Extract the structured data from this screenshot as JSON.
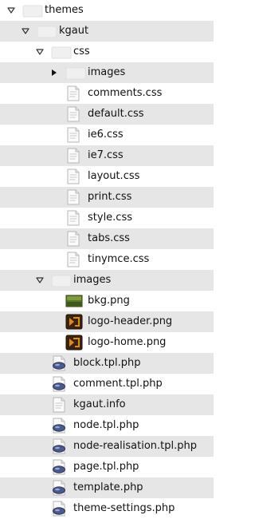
{
  "tree": [
    {
      "label": "themes",
      "kind": "folder",
      "state": "expanded",
      "level": 0
    },
    {
      "label": "kgaut",
      "kind": "folder",
      "state": "expanded",
      "level": 1
    },
    {
      "label": "css",
      "kind": "folder",
      "state": "expanded",
      "level": 2
    },
    {
      "label": "images",
      "kind": "folder",
      "state": "collapsed",
      "level": 3
    },
    {
      "label": "comments.css",
      "kind": "text-file",
      "level": 3
    },
    {
      "label": "default.css",
      "kind": "text-file",
      "level": 3
    },
    {
      "label": "ie6.css",
      "kind": "text-file",
      "level": 3
    },
    {
      "label": "ie7.css",
      "kind": "text-file",
      "level": 3
    },
    {
      "label": "layout.css",
      "kind": "text-file",
      "level": 3
    },
    {
      "label": "print.css",
      "kind": "text-file",
      "level": 3
    },
    {
      "label": "style.css",
      "kind": "text-file",
      "level": 3
    },
    {
      "label": "tabs.css",
      "kind": "text-file",
      "level": 3
    },
    {
      "label": "tinymce.css",
      "kind": "text-file",
      "level": 3
    },
    {
      "label": "images",
      "kind": "folder",
      "state": "expanded",
      "level": 2
    },
    {
      "label": "bkg.png",
      "kind": "image-green",
      "level": 3
    },
    {
      "label": "logo-header.png",
      "kind": "image-logo",
      "level": 3
    },
    {
      "label": "logo-home.png",
      "kind": "image-logo",
      "level": 3
    },
    {
      "label": "block.tpl.php",
      "kind": "php-file",
      "level": 2
    },
    {
      "label": "comment.tpl.php",
      "kind": "php-file",
      "level": 2
    },
    {
      "label": "kgaut.info",
      "kind": "text-file",
      "level": 2
    },
    {
      "label": "node.tpl.php",
      "kind": "php-file",
      "level": 2
    },
    {
      "label": "node-realisation.tpl.php",
      "kind": "php-file",
      "level": 2
    },
    {
      "label": "page.tpl.php",
      "kind": "php-file",
      "level": 2
    },
    {
      "label": "template.php",
      "kind": "php-file",
      "level": 2
    },
    {
      "label": "theme-settings.php",
      "kind": "php-file",
      "level": 2
    }
  ],
  "colors": {
    "alt_row": "#e6e6e6",
    "folder": "#f0f0f0",
    "logo_bg": "#3a2410",
    "logo_fg": "#e08a1e",
    "image_green": "#5a7a2a"
  }
}
